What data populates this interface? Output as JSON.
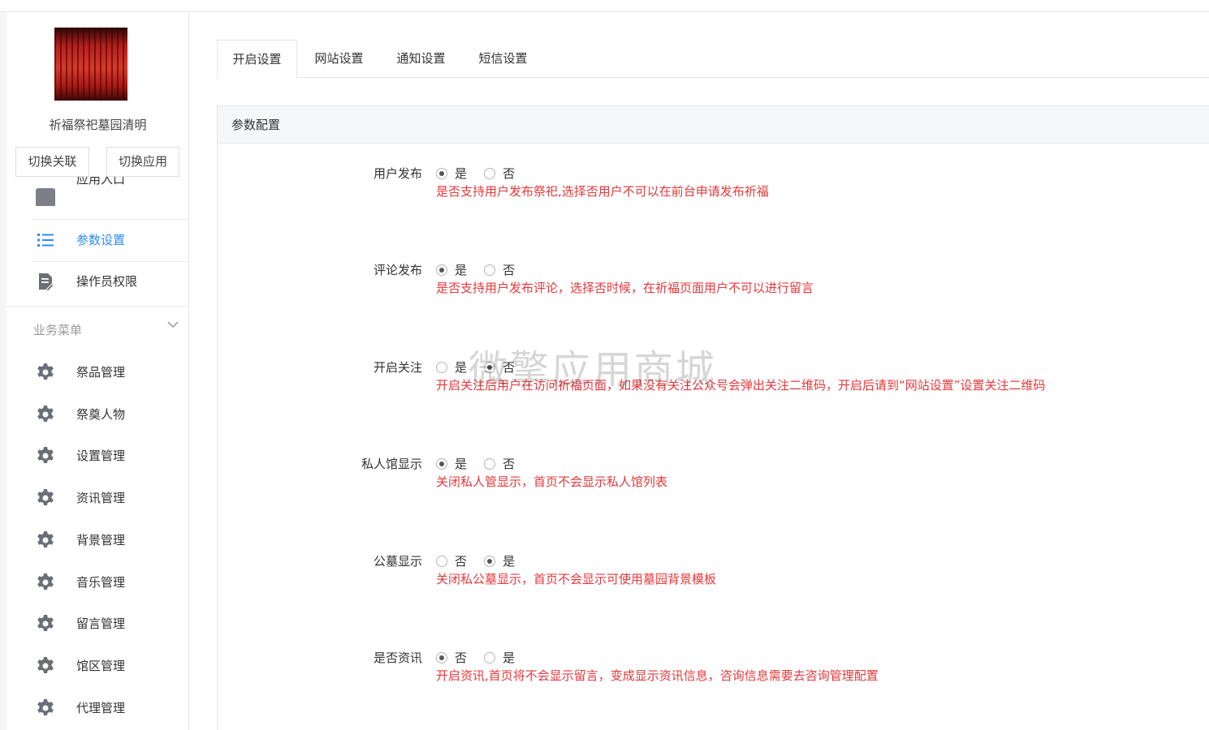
{
  "app": {
    "name": "祈福祭祀墓园清明"
  },
  "sidebar": {
    "switch_link_label": "切换关联",
    "switch_app_label": "切换应用",
    "partial_item_label": "应用入口",
    "items": [
      {
        "label": "参数设置",
        "icon": "list-icon",
        "active": true
      },
      {
        "label": "操作员权限",
        "icon": "document-edit-icon",
        "active": false
      }
    ],
    "group": {
      "label": "业务菜单",
      "items": [
        {
          "label": "祭品管理",
          "icon": "gear-icon"
        },
        {
          "label": "祭奠人物",
          "icon": "gear-icon"
        },
        {
          "label": "设置管理",
          "icon": "gear-icon"
        },
        {
          "label": "资讯管理",
          "icon": "gear-icon"
        },
        {
          "label": "背景管理",
          "icon": "gear-icon"
        },
        {
          "label": "音乐管理",
          "icon": "gear-icon"
        },
        {
          "label": "留言管理",
          "icon": "gear-icon"
        },
        {
          "label": "馆区管理",
          "icon": "gear-icon"
        },
        {
          "label": "代理管理",
          "icon": "gear-icon"
        }
      ]
    }
  },
  "tabs": [
    {
      "label": "开启设置",
      "active": true
    },
    {
      "label": "网站设置",
      "active": false
    },
    {
      "label": "通知设置",
      "active": false
    },
    {
      "label": "短信设置",
      "active": false
    }
  ],
  "panel": {
    "title": "参数配置"
  },
  "fields": [
    {
      "label": "用户发布",
      "options": [
        "是",
        "否"
      ],
      "selected": 0,
      "hint": "是否支持用户发布祭祀,选择否用户不可以在前台申请发布祈福"
    },
    {
      "label": "评论发布",
      "options": [
        "是",
        "否"
      ],
      "selected": 0,
      "hint": "是否支持用户发布评论，选择否时候，在祈福页面用户不可以进行留言"
    },
    {
      "label": "开启关注",
      "options": [
        "是",
        "否"
      ],
      "selected": 1,
      "hint": "开启关注后用户在访问祈福页面，如果没有关注公众号会弹出关注二维码，开启后请到“网站设置”设置关注二维码"
    },
    {
      "label": "私人馆显示",
      "options": [
        "是",
        "否"
      ],
      "selected": 0,
      "hint": "关闭私人管显示，首页不会显示私人馆列表"
    },
    {
      "label": "公墓显示",
      "options": [
        "否",
        "是"
      ],
      "selected": 1,
      "hint": "关闭私公墓显示，首页不会显示可使用墓园背景模板"
    },
    {
      "label": "是否资讯",
      "options": [
        "否",
        "是"
      ],
      "selected": 0,
      "hint": "开启资讯,首页将不会显示留言，变成显示资讯信息，咨询信息需要去咨询管理配置"
    }
  ],
  "watermark": "微擎应用商城",
  "colors": {
    "accent": "#2d8cf0",
    "hint": "#e4393c"
  }
}
